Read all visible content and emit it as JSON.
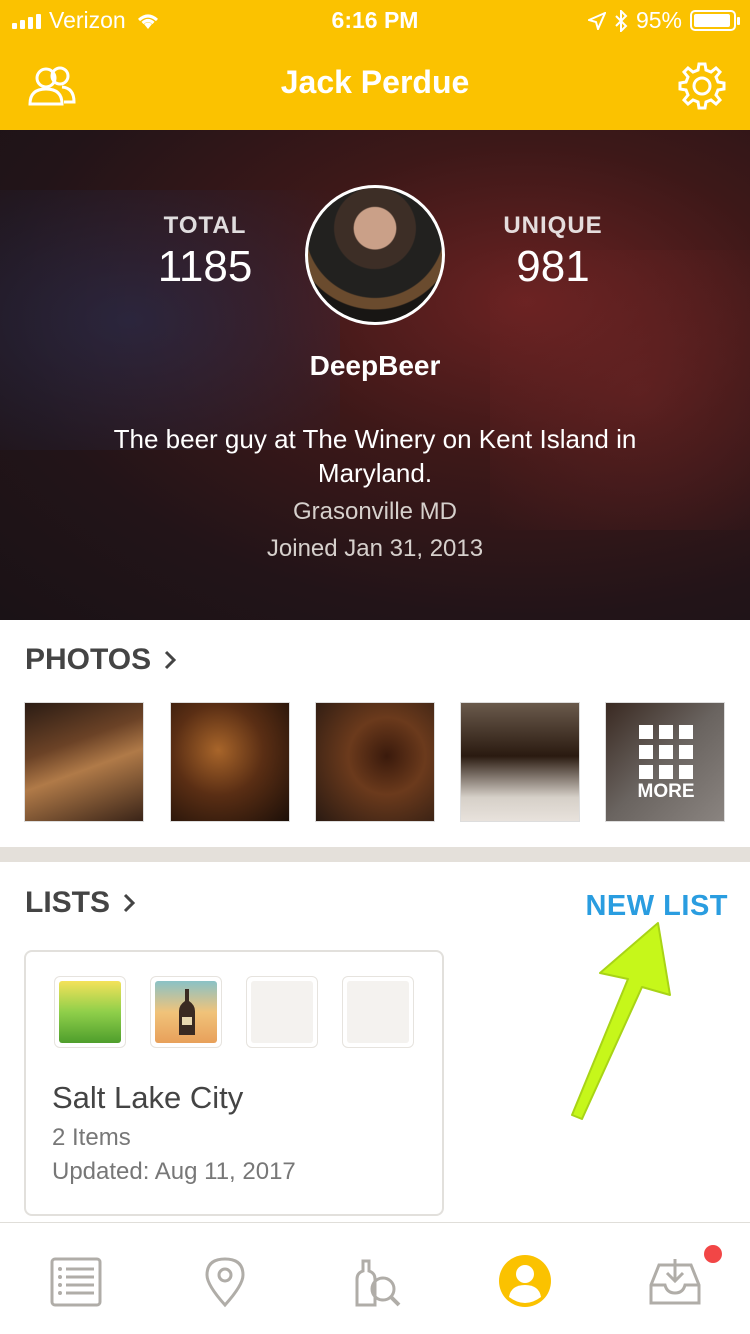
{
  "status_bar": {
    "carrier": "Verizon",
    "time": "6:16 PM",
    "battery": "95%"
  },
  "header": {
    "title": "Jack Perdue",
    "left_icon": "friends-icon",
    "right_icon": "settings-gear-icon"
  },
  "profile": {
    "total_label": "TOTAL",
    "total_value": "1185",
    "unique_label": "UNIQUE",
    "unique_value": "981",
    "username": "DeepBeer",
    "bio": "The beer guy at The Winery on Kent Island in Maryland.",
    "location": "Grasonville MD",
    "joined": "Joined Jan 31, 2013"
  },
  "photos": {
    "title": "PHOTOS",
    "more_label": "MORE",
    "count_shown": 5
  },
  "lists": {
    "title": "LISTS",
    "new_list_label": "NEW LIST",
    "items": [
      {
        "name": "Salt Lake City",
        "count": "2 Items",
        "updated": "Updated: Aug 11, 2017"
      }
    ]
  },
  "tab_bar": {
    "tabs": [
      "feed-icon",
      "places-icon",
      "beer-search-icon",
      "profile-icon",
      "inbox-icon"
    ],
    "active": "profile-icon"
  },
  "colors": {
    "brand_yellow": "#fbc200",
    "link_blue": "#2a9de0",
    "arrow_green": "#c6f71a",
    "badge_red": "#f24646"
  }
}
